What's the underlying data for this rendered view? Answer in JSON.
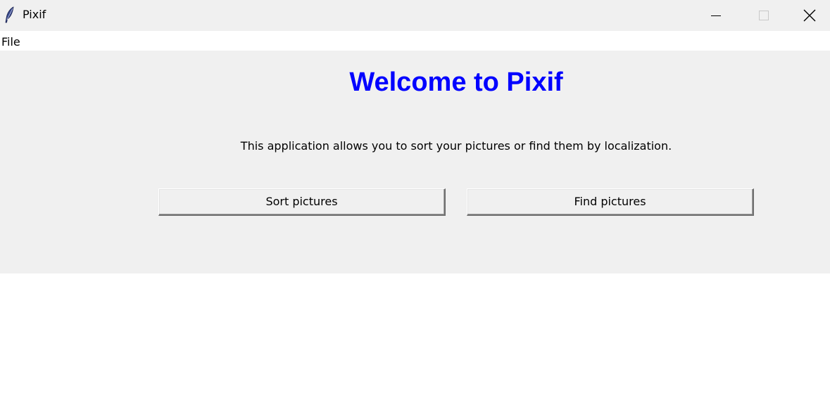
{
  "window": {
    "title": "Pixif",
    "icon": "feather-icon",
    "controls": [
      "minimize-icon",
      "maximize-icon",
      "close-icon"
    ]
  },
  "menubar": {
    "items": [
      {
        "label": "File"
      }
    ]
  },
  "main": {
    "heading": "Welcome to Pixif",
    "description": "This application allows you to sort your pictures or find them by localization.",
    "buttons": {
      "sort_label": "Sort pictures",
      "find_label": "Find pictures"
    }
  },
  "colors": {
    "heading": "#0000ff",
    "frame_background": "#f0f0f0",
    "window_background": "#ffffff"
  }
}
